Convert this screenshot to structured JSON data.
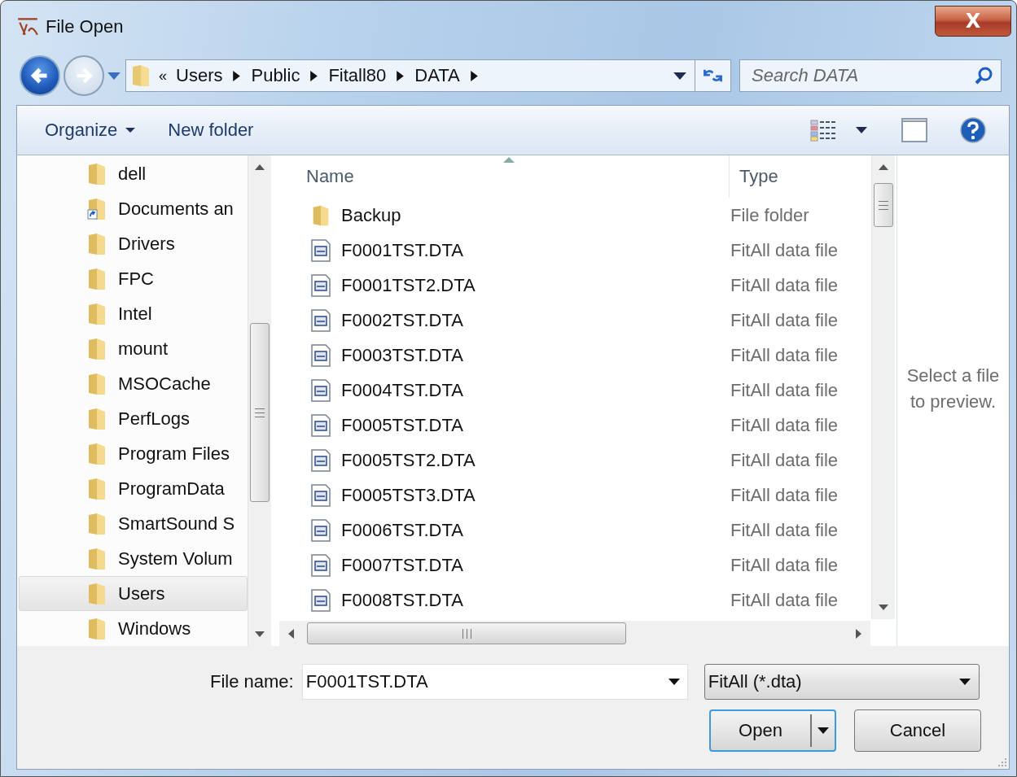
{
  "window": {
    "title": "File Open",
    "close_label": "X"
  },
  "address": {
    "overflow": "«",
    "crumbs": [
      "Users",
      "Public",
      "Fitall80",
      "DATA"
    ]
  },
  "search": {
    "placeholder": "Search DATA"
  },
  "toolbar": {
    "organize": "Organize",
    "new_folder": "New folder"
  },
  "nav_tree": {
    "items": [
      {
        "label": "dell",
        "selected": false,
        "shortcut": false
      },
      {
        "label": "Documents an",
        "selected": false,
        "shortcut": true
      },
      {
        "label": "Drivers",
        "selected": false,
        "shortcut": false
      },
      {
        "label": "FPC",
        "selected": false,
        "shortcut": false
      },
      {
        "label": "Intel",
        "selected": false,
        "shortcut": false
      },
      {
        "label": "mount",
        "selected": false,
        "shortcut": false
      },
      {
        "label": "MSOCache",
        "selected": false,
        "shortcut": false
      },
      {
        "label": "PerfLogs",
        "selected": false,
        "shortcut": false
      },
      {
        "label": "Program Files",
        "selected": false,
        "shortcut": false
      },
      {
        "label": "ProgramData",
        "selected": false,
        "shortcut": false
      },
      {
        "label": "SmartSound S",
        "selected": false,
        "shortcut": false
      },
      {
        "label": "System Volum",
        "selected": false,
        "shortcut": false
      },
      {
        "label": "Users",
        "selected": true,
        "shortcut": false
      },
      {
        "label": "Windows",
        "selected": false,
        "shortcut": false
      }
    ]
  },
  "file_list": {
    "columns": [
      "Name",
      "Type"
    ],
    "rows": [
      {
        "kind": "folder",
        "name": "Backup",
        "type": "File folder"
      },
      {
        "kind": "file",
        "name": "F0001TST.DTA",
        "type": "FitAll data file"
      },
      {
        "kind": "file",
        "name": "F0001TST2.DTA",
        "type": "FitAll data file"
      },
      {
        "kind": "file",
        "name": "F0002TST.DTA",
        "type": "FitAll data file"
      },
      {
        "kind": "file",
        "name": "F0003TST.DTA",
        "type": "FitAll data file"
      },
      {
        "kind": "file",
        "name": "F0004TST.DTA",
        "type": "FitAll data file"
      },
      {
        "kind": "file",
        "name": "F0005TST.DTA",
        "type": "FitAll data file"
      },
      {
        "kind": "file",
        "name": "F0005TST2.DTA",
        "type": "FitAll data file"
      },
      {
        "kind": "file",
        "name": "F0005TST3.DTA",
        "type": "FitAll data file"
      },
      {
        "kind": "file",
        "name": "F0006TST.DTA",
        "type": "FitAll data file"
      },
      {
        "kind": "file",
        "name": "F0007TST.DTA",
        "type": "FitAll data file"
      },
      {
        "kind": "file",
        "name": "F0008TST.DTA",
        "type": "FitAll data file"
      }
    ]
  },
  "preview": {
    "message": "Select a file to preview."
  },
  "file_name": {
    "label": "File name:",
    "value": "F0001TST.DTA"
  },
  "file_type": {
    "value": "FitAll (*.dta)"
  },
  "buttons": {
    "open": "Open",
    "cancel": "Cancel"
  }
}
